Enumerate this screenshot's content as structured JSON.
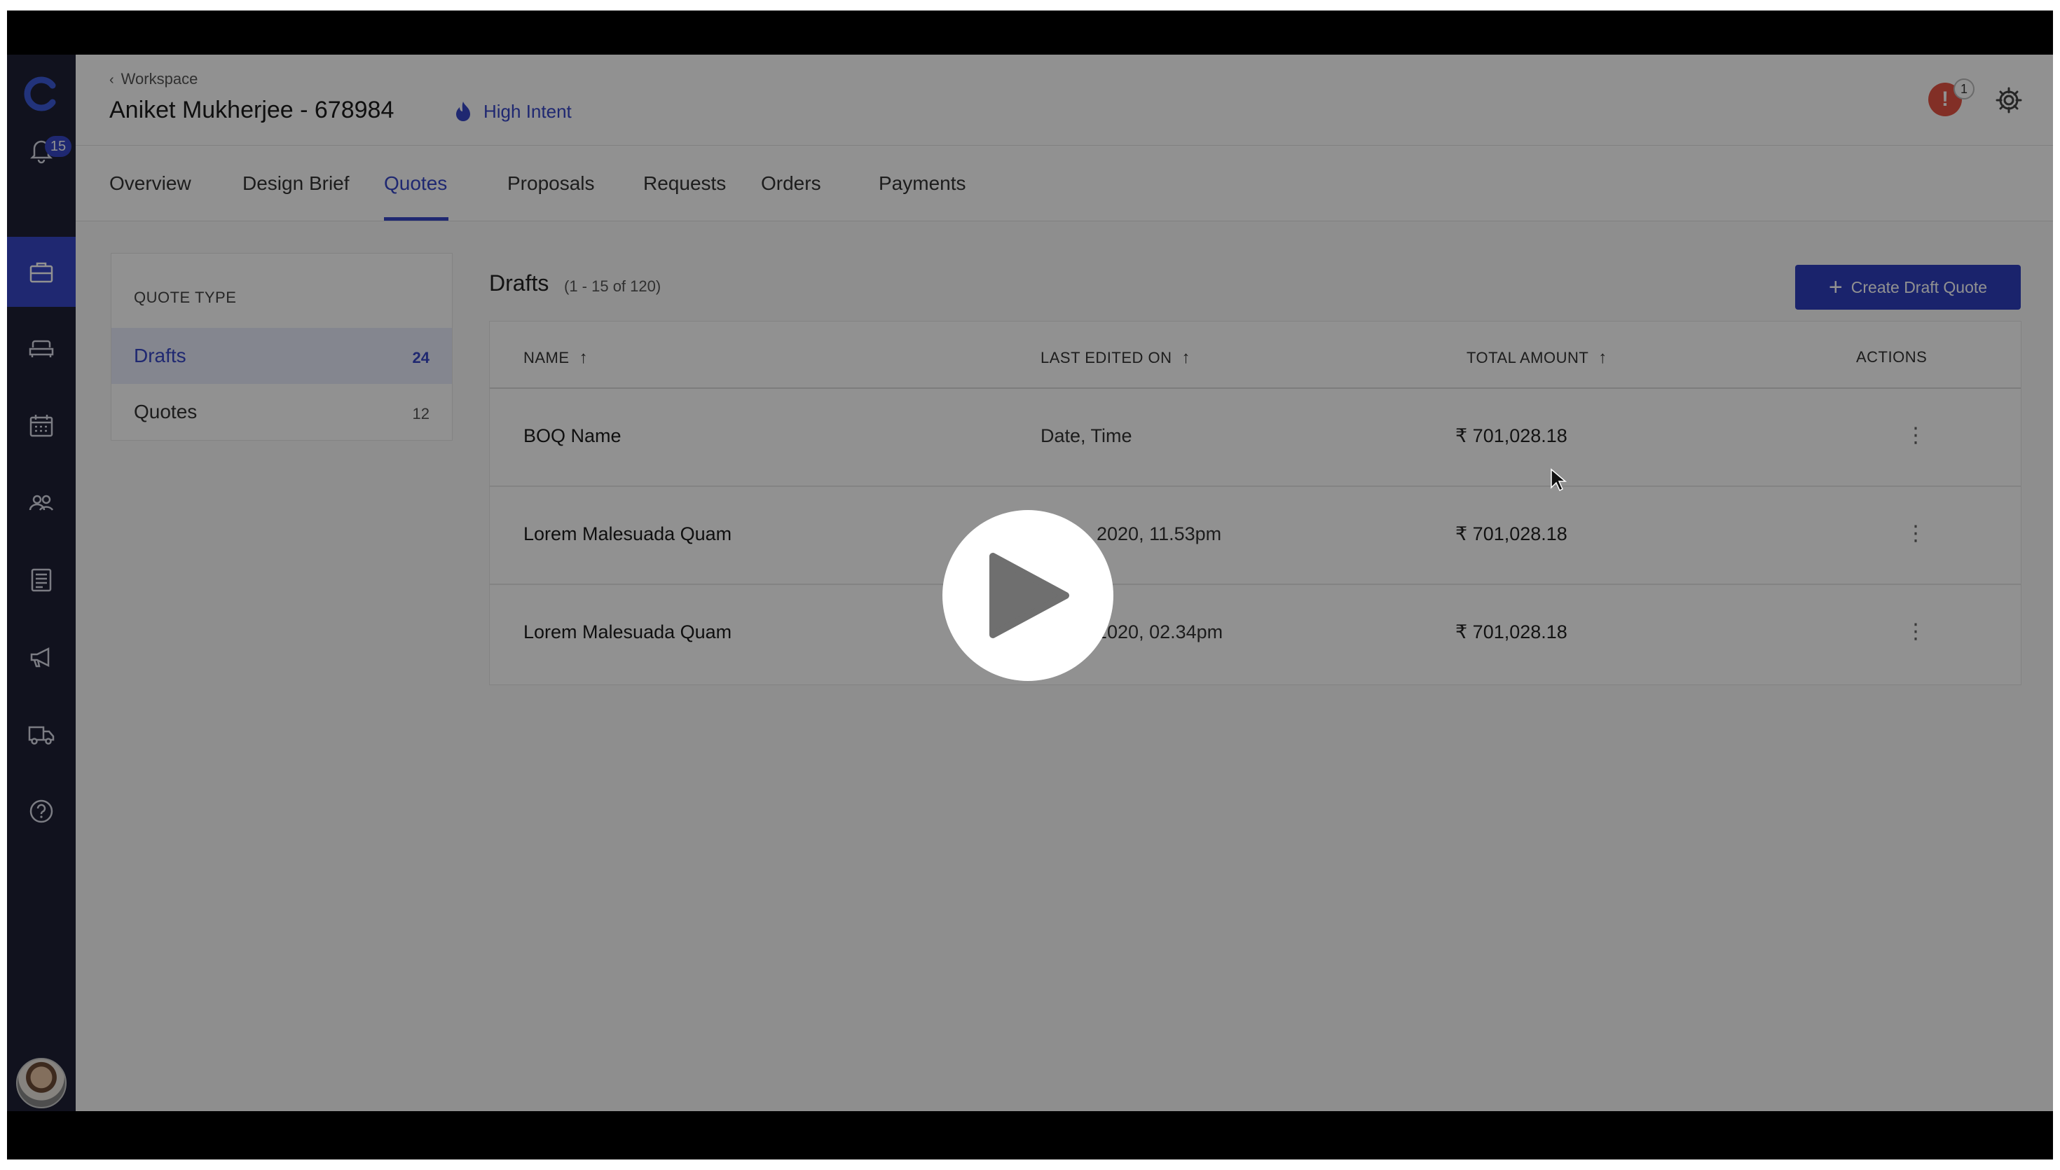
{
  "sidebar": {
    "notification_count": "15",
    "items": [
      {
        "icon": "bell-icon"
      },
      {
        "icon": "briefcase-icon",
        "active": true
      },
      {
        "icon": "sofa-icon"
      },
      {
        "icon": "calendar-icon"
      },
      {
        "icon": "users-icon"
      },
      {
        "icon": "document-icon"
      },
      {
        "icon": "megaphone-icon"
      },
      {
        "icon": "truck-icon"
      },
      {
        "icon": "help-icon"
      }
    ]
  },
  "header": {
    "breadcrumb": "Workspace",
    "title": "Aniket Mukherjee - 678984",
    "intent": "High Intent",
    "alert_icon": "!",
    "alert_count": "1"
  },
  "tabs": [
    "Overview",
    "Design Brief",
    "Quotes",
    "Proposals",
    "Requests",
    "Orders",
    "Payments"
  ],
  "active_tab": "Quotes",
  "quote_type": {
    "heading": "QUOTE TYPE",
    "items": [
      {
        "label": "Drafts",
        "count": "24",
        "active": true
      },
      {
        "label": "Quotes",
        "count": "12",
        "active": false
      }
    ]
  },
  "drafts": {
    "title": "Drafts",
    "range": "(1 - 15 of 120)",
    "create_button": "Create Draft Quote",
    "columns": [
      "NAME",
      "LAST EDITED ON",
      "TOTAL AMOUNT",
      "ACTIONS"
    ],
    "rows": [
      {
        "name": "BOQ Name",
        "date": "Date, Time",
        "amount": "₹ 701,028.18"
      },
      {
        "name": "Lorem Malesuada Quam",
        "date": "2020, 11.53pm",
        "amount": "₹ 701,028.18"
      },
      {
        "name": "Lorem Malesuada Quam",
        "date": "2020, 02.34pm",
        "amount": "₹ 701,028.18"
      }
    ]
  },
  "actions_icon": "⋮",
  "colors": {
    "accent": "#3747c7",
    "sidebar": "#1e2136",
    "alert": "#e45343"
  }
}
